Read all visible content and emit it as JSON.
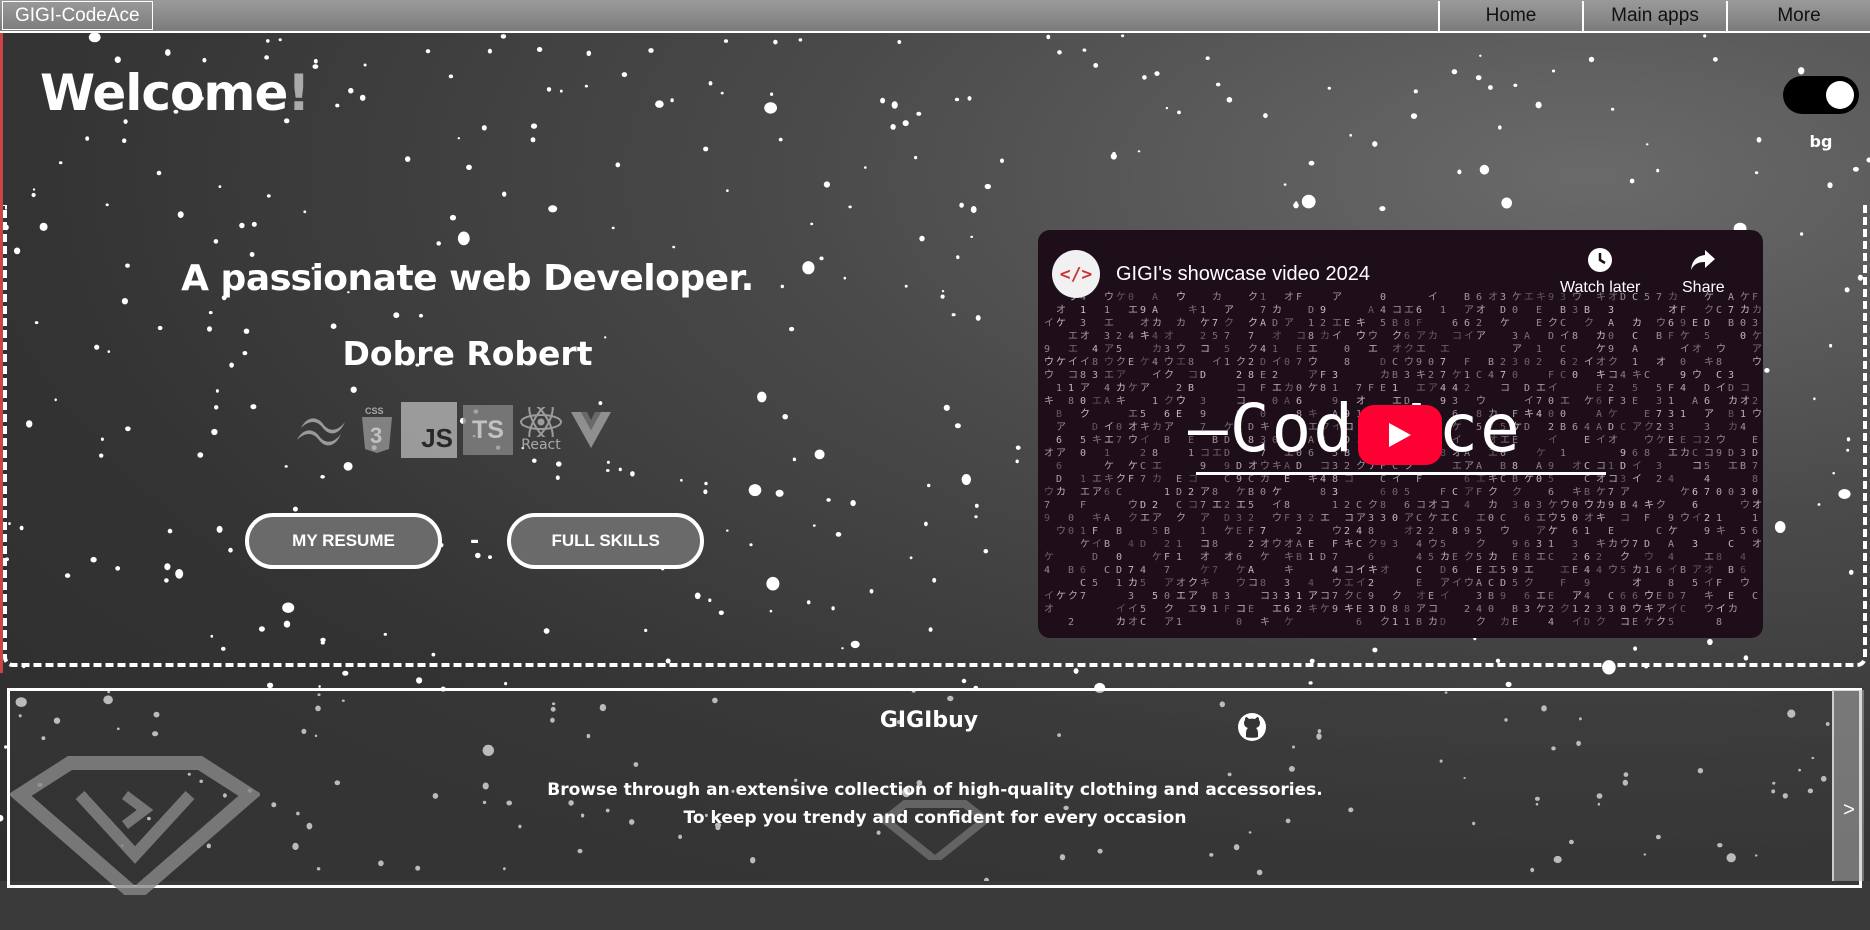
{
  "topbar": {
    "brand": "GIGI-CodeAce",
    "nav": [
      "Home",
      "Main apps",
      "More"
    ]
  },
  "hero": {
    "welcome": "Welcome",
    "welcome_bang": "!",
    "toggle_label": "bg",
    "tagline": "A passionate web Developer.",
    "name": "Dobre Robert",
    "skills": {
      "css_label": "CSS",
      "js": "JS",
      "ts": "TS",
      "react": "React"
    },
    "resume_button": "MY RESUME",
    "separator": "-",
    "skills_button": "FULL SKILLS"
  },
  "video": {
    "logo_text": "</>",
    "title": "GIGI's showcase video 2024",
    "watch_later": "Watch later",
    "share": "Share",
    "watermark": "—CodeAce"
  },
  "card": {
    "title": "GIGIbuy",
    "line1": "Browse through an extensive collection of high-quality clothing and accessories.",
    "line2": "To keep you trendy and confident for every occasion",
    "next": ">"
  },
  "colors": {
    "accent_play": "#ff0033",
    "video_bg": "#1d0e1a",
    "button_bg": "#6a6a6a"
  }
}
